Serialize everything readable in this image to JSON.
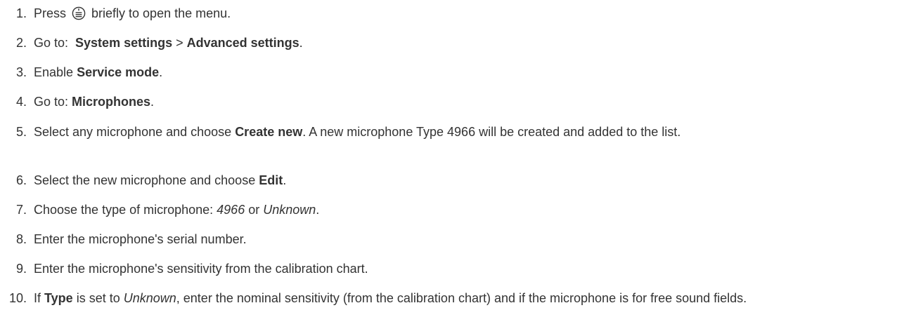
{
  "steps": [
    {
      "number": "1.",
      "parts": [
        {
          "t": "Press "
        },
        {
          "icon": "menu-button-icon"
        },
        {
          "t": " briefly to open the menu."
        }
      ]
    },
    {
      "number": "2.",
      "parts": [
        {
          "t": "Go to:  "
        },
        {
          "b": "System settings"
        },
        {
          "t": " > "
        },
        {
          "b": "Advanced settings"
        },
        {
          "t": "."
        }
      ]
    },
    {
      "number": "3.",
      "parts": [
        {
          "t": "Enable "
        },
        {
          "b": "Service mode"
        },
        {
          "t": "."
        }
      ]
    },
    {
      "number": "4.",
      "parts": [
        {
          "t": "Go to: "
        },
        {
          "b": "Microphones"
        },
        {
          "t": "."
        }
      ]
    },
    {
      "number": "5.",
      "parts": [
        {
          "t": "Select any microphone and choose "
        },
        {
          "b": "Create new"
        },
        {
          "t": ". A new microphone Type 4966 will be created and added to the list."
        }
      ]
    },
    {
      "number": "6.",
      "parts": [
        {
          "t": "Select the new microphone and choose "
        },
        {
          "b": "Edit"
        },
        {
          "t": "."
        }
      ]
    },
    {
      "number": "7.",
      "parts": [
        {
          "t": "Choose the type of microphone: "
        },
        {
          "i": "4966"
        },
        {
          "t": " or "
        },
        {
          "i": "Unknown"
        },
        {
          "t": "."
        }
      ]
    },
    {
      "number": "8.",
      "parts": [
        {
          "t": "Enter the microphone's serial number."
        }
      ]
    },
    {
      "number": "9.",
      "parts": [
        {
          "t": "Enter the microphone's sensitivity from the calibration chart."
        }
      ]
    },
    {
      "number": "10.",
      "parts": [
        {
          "t": "If "
        },
        {
          "b": "Type"
        },
        {
          "t": " is set to "
        },
        {
          "i": "Unknown"
        },
        {
          "t": ", enter the nominal sensitivity (from the calibration chart) and if the microphone is for free sound fields."
        }
      ]
    }
  ]
}
